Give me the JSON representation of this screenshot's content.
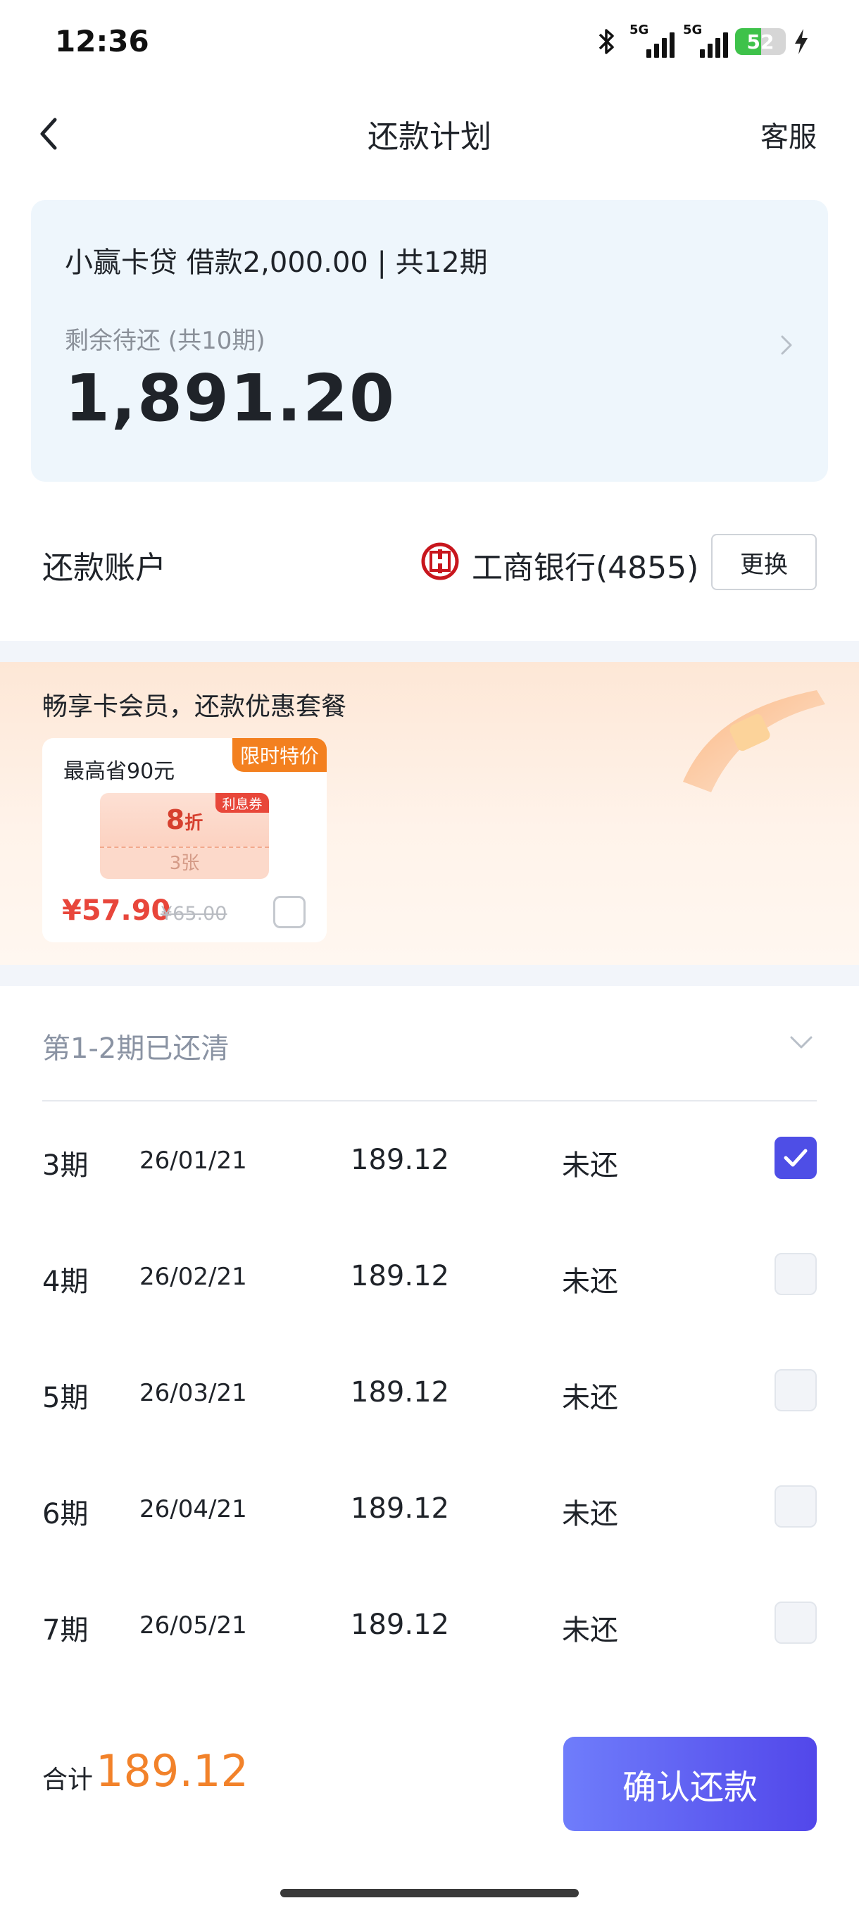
{
  "status_bar": {
    "time": "12:36",
    "sim1_label": "5G",
    "sim2_label": "5G",
    "battery_level": "52",
    "battery_fraction": 0.52,
    "battery_color": "#3ec24a"
  },
  "nav": {
    "title": "还款计划",
    "service_label": "客服",
    "back_icon": "chevron-left-icon"
  },
  "loan": {
    "title": "小赢卡贷 借款2,000.00 | 共12期",
    "remaining_label": "剩余待还 (共10期)",
    "remaining_amount": "1,891.20"
  },
  "account": {
    "label": "还款账户",
    "bank_name": "工商银行(4855)",
    "bank_icon": "icbc-logo-icon",
    "change_label": "更换"
  },
  "promo": {
    "title": "畅享卡会员，还款优惠套餐",
    "save_text": "最高省90元",
    "tag": "限时特价",
    "coupon_badge": "利息券",
    "coupon_discount": "8",
    "coupon_discount_unit": "折",
    "coupon_count": "3张",
    "price": "¥57.90",
    "original_price": "¥65.00",
    "selected": false
  },
  "paid_summary": "第1-2期已还清",
  "installments": [
    {
      "period": "3期",
      "date": "26/01/21",
      "amount": "189.12",
      "status": "未还",
      "checked": true
    },
    {
      "period": "4期",
      "date": "26/02/21",
      "amount": "189.12",
      "status": "未还",
      "checked": false
    },
    {
      "period": "5期",
      "date": "26/03/21",
      "amount": "189.12",
      "status": "未还",
      "checked": false
    },
    {
      "period": "6期",
      "date": "26/04/21",
      "amount": "189.12",
      "status": "未还",
      "checked": false
    },
    {
      "period": "7期",
      "date": "26/05/21",
      "amount": "189.12",
      "status": "未还",
      "checked": false
    }
  ],
  "footer": {
    "total_label": "合计",
    "total_amount": "189.12",
    "confirm_label": "确认还款"
  },
  "colors": {
    "accent": "#5247ea",
    "total": "#f2822a",
    "promo_tag": "#f3801f",
    "price": "#e8463b"
  }
}
